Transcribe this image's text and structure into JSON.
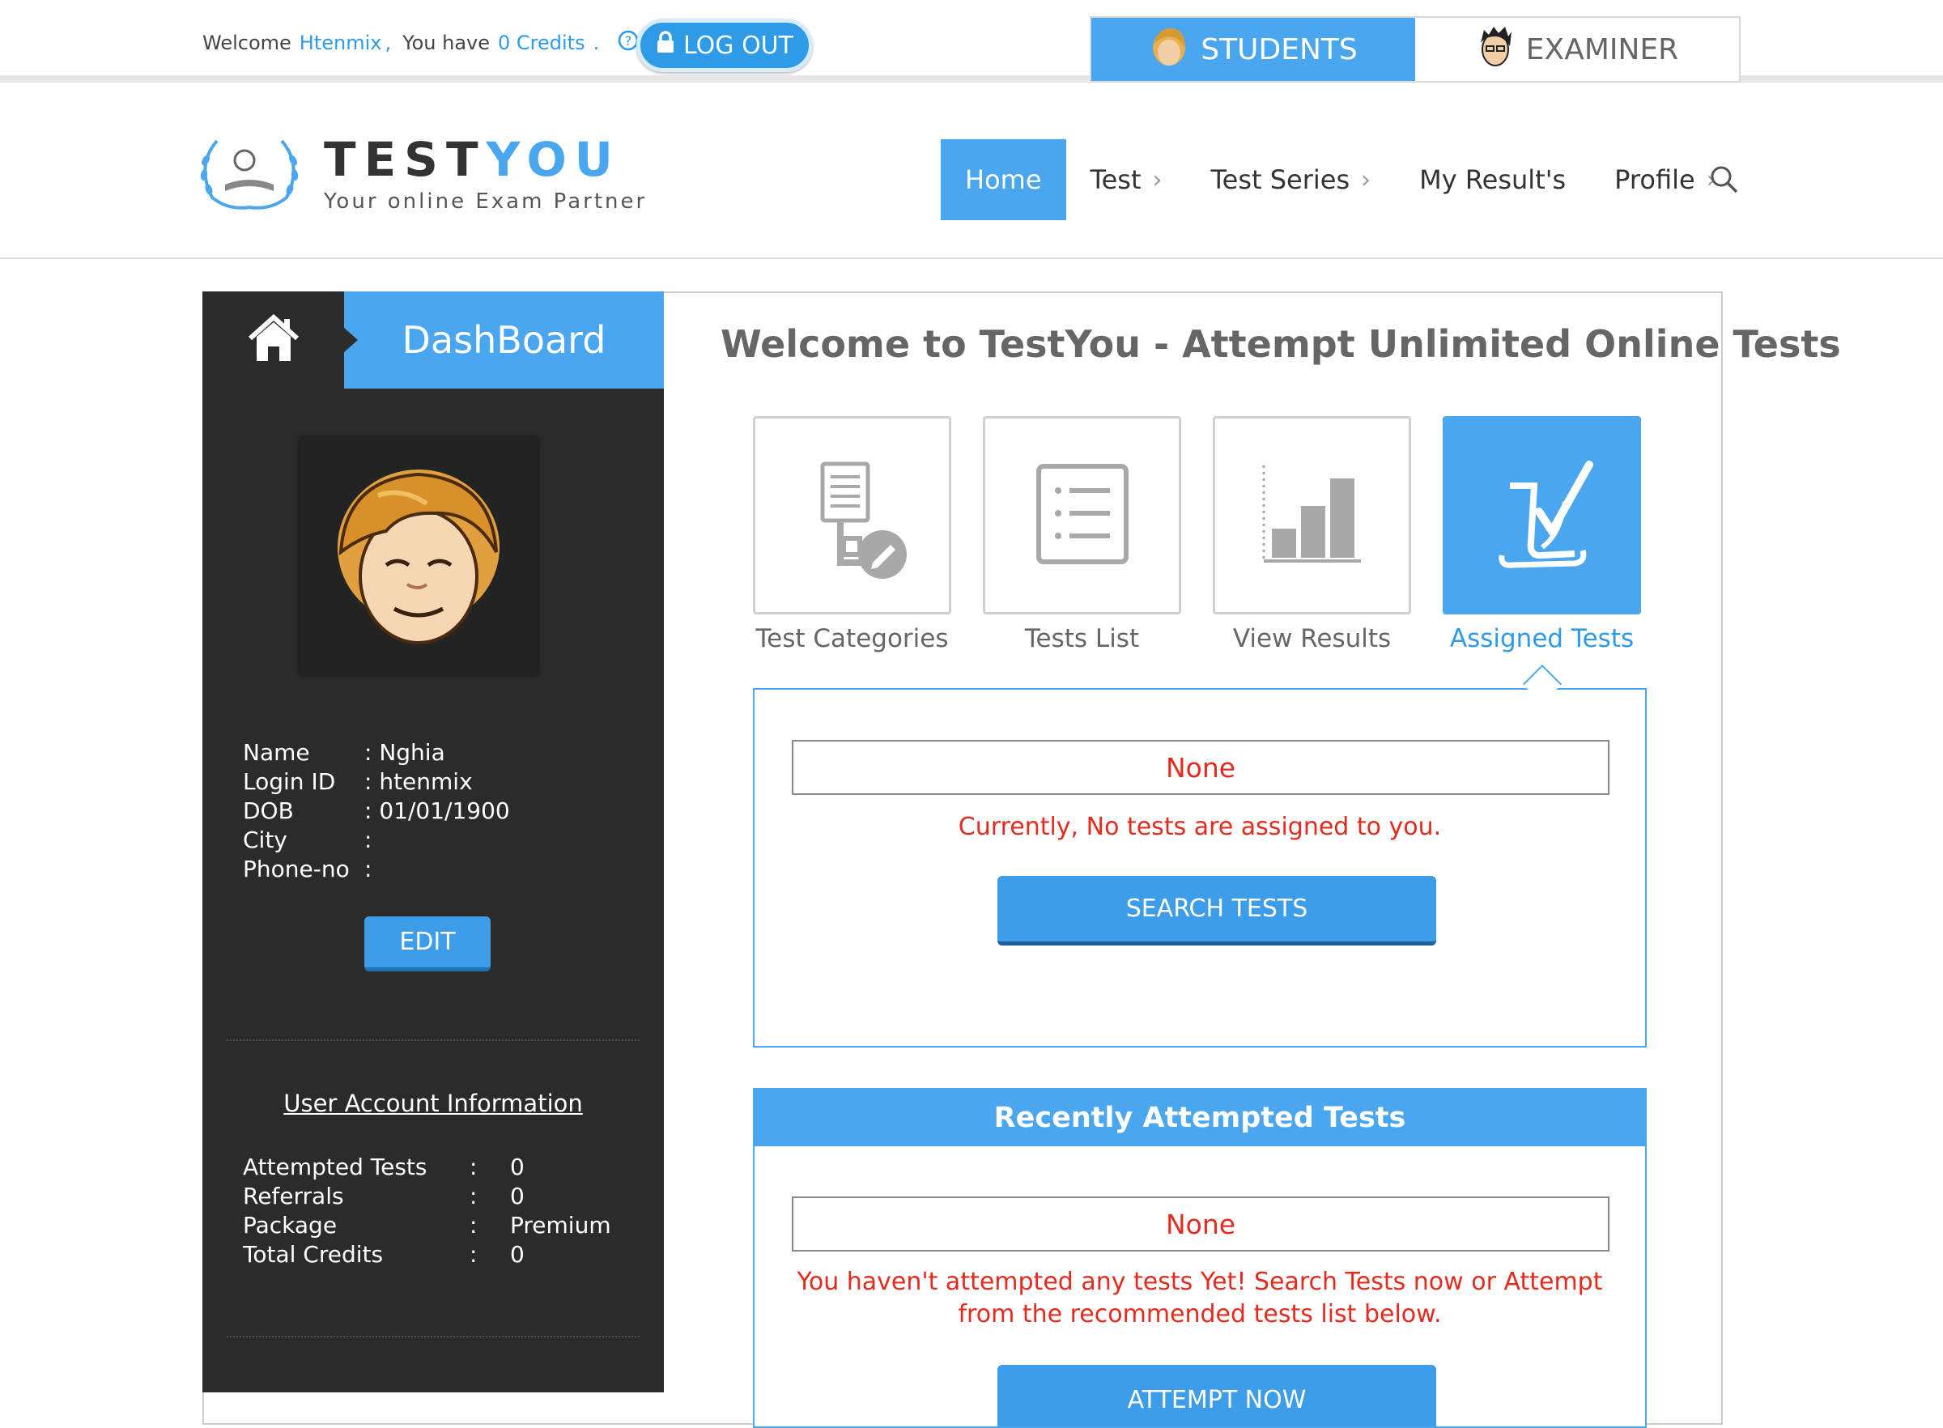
{
  "topbar": {
    "welcome_prefix": "Welcome",
    "username": "Htenmix",
    "comma": ",",
    "you_have": "You have",
    "credits": "0 Credits",
    "credits_dot": ".",
    "logout_label": "LOG OUT",
    "roles": [
      {
        "label": "STUDENTS",
        "active": true
      },
      {
        "label": "EXAMINER",
        "active": false
      }
    ]
  },
  "logo": {
    "title_part1": "TEST",
    "title_part2": "YOU",
    "tagline": "Your online Exam Partner"
  },
  "nav": [
    {
      "label": "Home",
      "active": true
    },
    {
      "label": "Test",
      "chevron": true
    },
    {
      "label": "Test Series",
      "chevron": true
    },
    {
      "label": "My Result's"
    },
    {
      "label": "Profile",
      "chevron": true
    }
  ],
  "sidebar": {
    "title": "DashBoard",
    "profile": [
      {
        "key": "Name",
        "value": ": Nghia"
      },
      {
        "key": "Login ID",
        "value": ": htenmix"
      },
      {
        "key": "DOB",
        "value": ": 01/01/1900"
      },
      {
        "key": "City",
        "value": ":"
      },
      {
        "key": "Phone-no",
        "value": ":"
      }
    ],
    "edit_label": "EDIT",
    "account_title": "User Account Information",
    "account": [
      {
        "key": "Attempted Tests",
        "colon": ":",
        "value": "0"
      },
      {
        "key": "Referrals",
        "colon": ":",
        "value": "0"
      },
      {
        "key": "Package",
        "colon": ":",
        "value": "Premium"
      },
      {
        "key": "Total Credits",
        "colon": ":",
        "value": "0"
      }
    ]
  },
  "main": {
    "title": "Welcome to TestYou - Attempt Unlimited Online Tests",
    "tiles": [
      {
        "label": "Test Categories",
        "icon": "categories-icon"
      },
      {
        "label": "Tests List",
        "icon": "list-icon"
      },
      {
        "label": "View Results",
        "icon": "bar-chart-icon"
      },
      {
        "label": "Assigned Tests",
        "icon": "checkmark-icon",
        "active": true
      }
    ],
    "assigned": {
      "none_label": "None",
      "message": "Currently, No tests are assigned to you.",
      "button": "SEARCH TESTS"
    },
    "recent": {
      "title": "Recently Attempted Tests",
      "none_label": "None",
      "message": "You haven't attempted any tests Yet! Search Tests now or Attempt from the recommended tests list below.",
      "button": "ATTEMPT NOW"
    }
  },
  "colors": {
    "accent": "#4aa6ee",
    "sidebar": "#2b2b2b",
    "error": "#e42b1d"
  }
}
